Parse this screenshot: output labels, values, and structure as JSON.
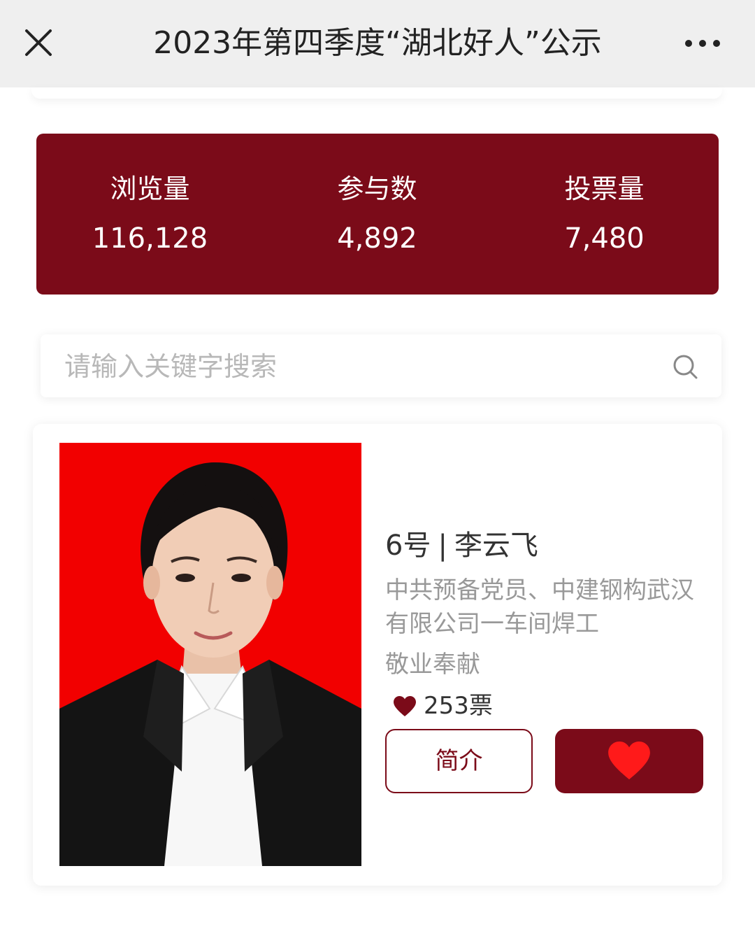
{
  "header": {
    "title": "2023年第四季度“湖北好人”公示",
    "close_icon": "close-icon",
    "more_icon": "more-horizontal-icon"
  },
  "stats": [
    {
      "label": "浏览量",
      "value": "116,128"
    },
    {
      "label": "参与数",
      "value": "4,892"
    },
    {
      "label": "投票量",
      "value": "7,480"
    }
  ],
  "search": {
    "placeholder": "请输入关键字搜索",
    "icon": "search-icon"
  },
  "candidate": {
    "number": "6号",
    "separator": "|",
    "name": "李云飞",
    "description": "中共预备党员、中建钢构武汉有限公司一车间焊工",
    "category": "敬业奉献",
    "votes": "253票",
    "intro_button": "简介",
    "vote_icon": "heart-icon"
  },
  "colors": {
    "brand": "#7b0b19",
    "photo_background": "#f20000"
  }
}
